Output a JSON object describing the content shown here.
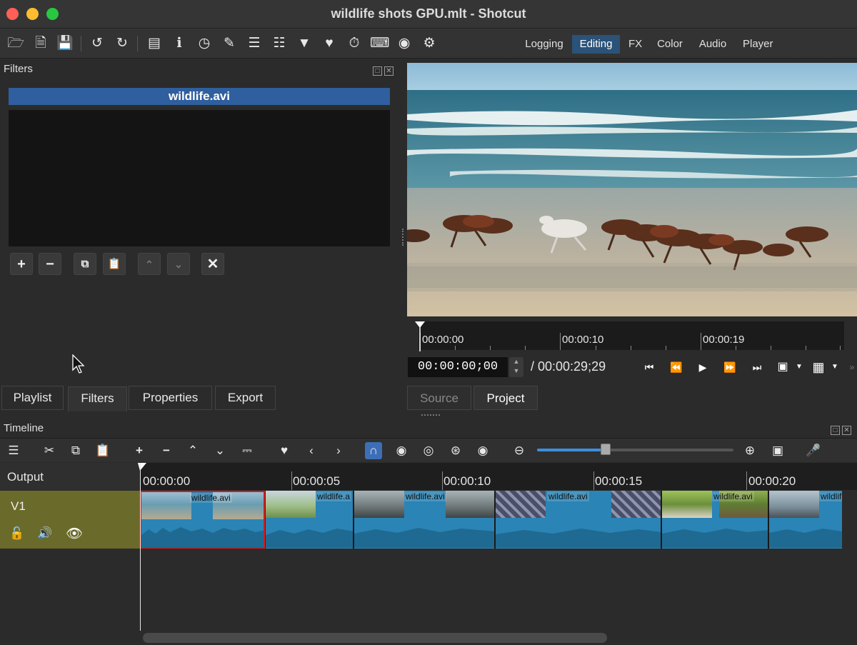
{
  "window": {
    "title": "wildlife shots GPU.mlt - Shotcut"
  },
  "toolbar": {
    "icons": [
      "open-icon",
      "open-other-icon",
      "save-icon",
      "undo-icon",
      "redo-icon",
      "peak-meter-icon",
      "properties-icon",
      "recent-icon",
      "notes-icon",
      "playlist-icon",
      "timeline-icon",
      "filters-icon",
      "markers-icon",
      "history-icon",
      "keyframes-icon",
      "export-icon",
      "settings-icon"
    ],
    "layouts": [
      "Logging",
      "Editing",
      "FX",
      "Color",
      "Audio",
      "Player"
    ],
    "active_layout": "Editing"
  },
  "filters_panel": {
    "title": "Filters",
    "clip_name": "wildlife.avi"
  },
  "left_tabs": [
    "Playlist",
    "Filters",
    "Properties",
    "Export"
  ],
  "active_left_tab": "Filters",
  "player": {
    "ruler_labels": [
      "00:00:00",
      "00:00:10",
      "00:00:19"
    ],
    "current_timecode": "00:00:00;00",
    "total_duration": "/ 00:00:29;29",
    "tabs": [
      "Source",
      "Project"
    ],
    "active_tab": "Project"
  },
  "timeline": {
    "title": "Timeline",
    "output_label": "Output",
    "track_name": "V1",
    "ruler_labels": [
      "00:00:00",
      "00:00:05",
      "00:00:10",
      "00:00:15",
      "00:00:20"
    ],
    "zoom_level": 0.35,
    "clips": [
      {
        "name": "wildlife.avi",
        "selected": true
      },
      {
        "name": "wildlife.a",
        "selected": false
      },
      {
        "name": "wildlife.avi",
        "selected": false
      },
      {
        "name": "wildlife.avi",
        "selected": false
      },
      {
        "name": "wildlife.avi",
        "selected": false
      },
      {
        "name": "wildlif",
        "selected": false
      }
    ]
  },
  "colors": {
    "accent": "#2b5278",
    "track_header": "#6a6a2b",
    "clip": "#2a84b5",
    "selected_clip_border": "#d02020"
  }
}
